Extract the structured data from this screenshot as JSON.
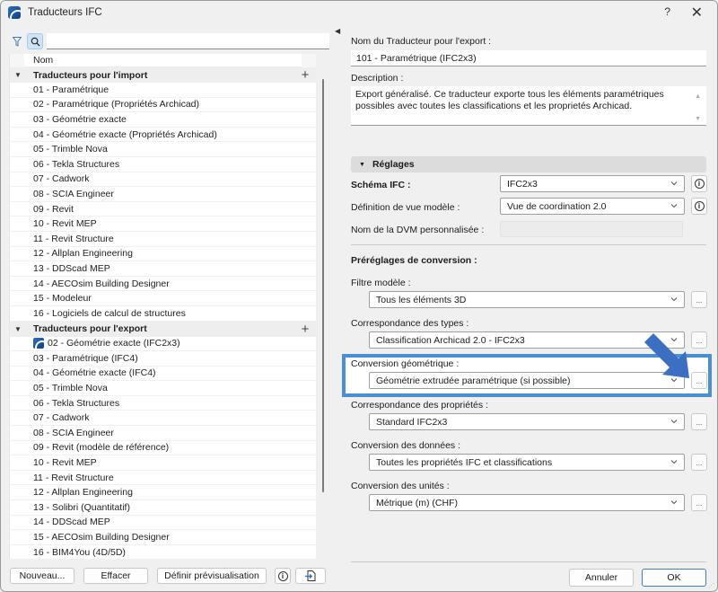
{
  "window": {
    "title": "Traducteurs IFC",
    "help_label": "?",
    "close_label": "✕"
  },
  "left": {
    "search": {
      "value": "",
      "placeholder": ""
    },
    "column_header": "Nom",
    "groups": [
      {
        "label": "Traducteurs pour l'import",
        "items": [
          "01 - Paramétrique",
          "02 - Paramétrique (Propriétés Archicad)",
          "03 - Géométrie exacte",
          "04 - Géométrie exacte (Propriétés Archicad)",
          "05 - Trimble Nova",
          "06 - Tekla Structures",
          "07 - Cadwork",
          "08 - SCIA Engineer",
          "09 - Revit",
          "10 - Revit MEP",
          "11 - Revit Structure",
          "12 - Allplan Engineering",
          "13 - DDScad MEP",
          "14 - AECOsim Building Designer",
          "15 - Modeleur",
          "16 - Logiciels de calcul de structures"
        ]
      },
      {
        "label": "Traducteurs pour l'export",
        "items": [
          "02 - Géométrie exacte (IFC2x3)",
          "03 - Paramétrique (IFC4)",
          "04 - Géométrie exacte (IFC4)",
          "05 - Trimble Nova",
          "06 - Tekla Structures",
          "07 - Cadwork",
          "08 - SCIA Engineer",
          "09 - Revit (modèle de référence)",
          "10 - Revit MEP",
          "11 - Revit Structure",
          "12 - Allplan Engineering",
          "13 - Solibri (Quantitatif)",
          "14 - DDScad MEP",
          "15 - AECOsim Building Designer",
          "16 - BIM4You (4D/5D)"
        ]
      }
    ],
    "buttons": {
      "new": "Nouveau...",
      "delete": "Effacer",
      "set_preview": "Définir prévisualisation",
      "info": "i"
    }
  },
  "right": {
    "name_label": "Nom du Traducteur pour l'export :",
    "name_value": "101 - Paramétrique (IFC2x3)",
    "description_label": "Description :",
    "description_value": "Export généralisé. Ce traducteur exporte tous les éléments paramétriques possibles avec toutes les classifications et les proprietés Archicad.",
    "settings_header": "Réglages",
    "schema_label": "Schéma IFC :",
    "schema_value": "IFC2x3",
    "mvd_label": "Définition de vue modèle :",
    "mvd_value": "Vue de coordination 2.0",
    "custom_mvd_label": "Nom de la DVM personnalisée :",
    "presets_label": "Préréglages de conversion :",
    "presets": [
      {
        "label": "Filtre modèle :",
        "value": "Tous les éléments 3D"
      },
      {
        "label": "Correspondance des types :",
        "value": "Classification Archicad 2.0 - IFC2x3"
      },
      {
        "label": "Conversion géométrique :",
        "value": "Géométrie extrudée paramétrique (si possible)"
      },
      {
        "label": "Correspondance des propriétés :",
        "value": "Standard IFC2x3"
      },
      {
        "label": "Conversion des données :",
        "value": "Toutes les propriétés IFC et classifications"
      },
      {
        "label": "Conversion des unités :",
        "value": "Métrique (m) (CHF)"
      }
    ],
    "more_label": "...",
    "cancel": "Annuler",
    "ok": "OK"
  },
  "colors": {
    "highlight": "#4a8fd6",
    "arrow": "#3b6fc2"
  }
}
